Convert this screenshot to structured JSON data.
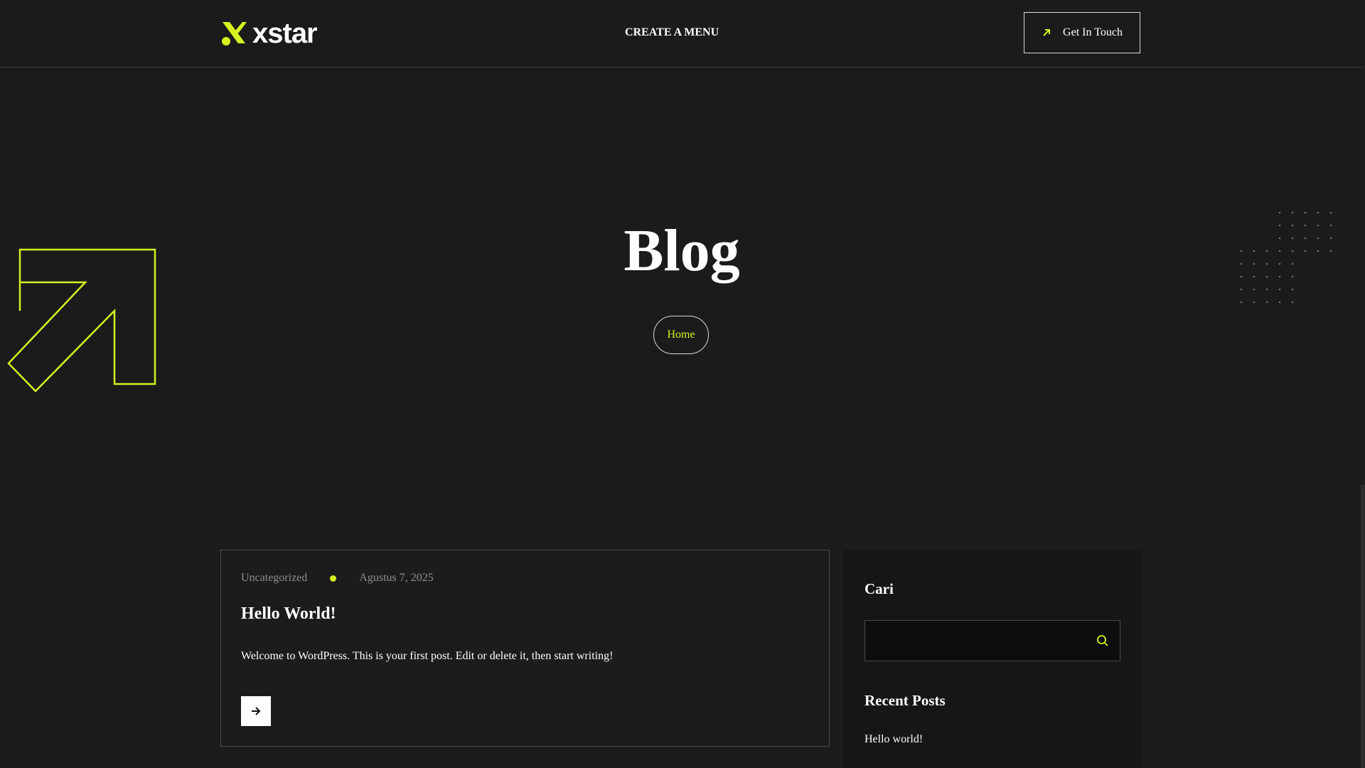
{
  "header": {
    "logo_text": "xstar",
    "menu_label": "CREATE A MENU",
    "cta_label": "Get In Touch"
  },
  "hero": {
    "title": "Blog",
    "breadcrumb": "Home"
  },
  "post": {
    "category": "Uncategorized",
    "date": "Agustus 7, 2025",
    "title": "Hello World!",
    "excerpt": "Welcome to WordPress. This is your first post. Edit or delete it, then start writing!"
  },
  "sidebar": {
    "search_title": "Cari",
    "search_value": "",
    "recent_title": "Recent Posts",
    "recent_posts": [
      "Hello world!"
    ]
  },
  "colors": {
    "accent": "#d7f21f",
    "background": "#1c1c1c"
  }
}
